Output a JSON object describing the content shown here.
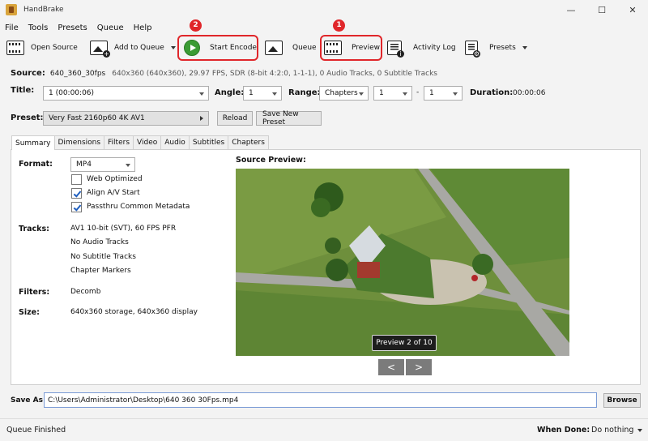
{
  "window": {
    "title": "HandBrake",
    "minimize": "—",
    "maximize": "☐",
    "close": "✕"
  },
  "menu": [
    "File",
    "Tools",
    "Presets",
    "Queue",
    "Help"
  ],
  "toolbar": {
    "open_source": "Open Source",
    "add_to_queue": "Add to Queue",
    "start_encode": "Start Encode",
    "queue": "Queue",
    "preview": "Preview",
    "activity_log": "Activity Log",
    "presets": "Presets"
  },
  "annotations": {
    "preview_num": "1",
    "start_encode_num": "2",
    "accent": "#e0262a"
  },
  "source": {
    "label": "Source:",
    "name": "640_360_30fps",
    "details": "640x360 (640x360), 29.97 FPS, SDR (8-bit 4:2:0, 1-1-1), 0 Audio Tracks, 0 Subtitle Tracks"
  },
  "title_row": {
    "title_label": "Title:",
    "title_value": "1 (00:00:06)",
    "angle_label": "Angle:",
    "angle_value": "1",
    "range_label": "Range:",
    "range_value": "Chapters",
    "range_start": "1",
    "range_dash": "-",
    "range_end": "1",
    "duration_label": "Duration:",
    "duration_value": "00:00:06"
  },
  "preset_row": {
    "label": "Preset:",
    "value": "Very Fast 2160p60 4K AV1",
    "reload": "Reload",
    "save_new": "Save New Preset"
  },
  "tabs": [
    "Summary",
    "Dimensions",
    "Filters",
    "Video",
    "Audio",
    "Subtitles",
    "Chapters"
  ],
  "summary": {
    "format_label": "Format:",
    "format_value": "MP4",
    "web_optimized": "Web Optimized",
    "align_av": "Align A/V Start",
    "passthru": "Passthru Common Metadata",
    "tracks_label": "Tracks:",
    "tracks": [
      "AV1 10-bit (SVT), 60 FPS PFR",
      "No Audio Tracks",
      "No Subtitle Tracks",
      "Chapter Markers"
    ],
    "filters_label": "Filters:",
    "filters_value": "Decomb",
    "size_label": "Size:",
    "size_value": "640x360 storage, 640x360 display",
    "source_preview_label": "Source Preview:",
    "preview_tag": "Preview 2 of 10",
    "prev": "<",
    "next": ">"
  },
  "save_as": {
    "label": "Save As:",
    "path": "C:\\Users\\Administrator\\Desktop\\640 360 30Fps.mp4",
    "browse": "Browse"
  },
  "status": {
    "text": "Queue Finished",
    "when_done_label": "When Done:",
    "when_done_value": "Do nothing"
  }
}
